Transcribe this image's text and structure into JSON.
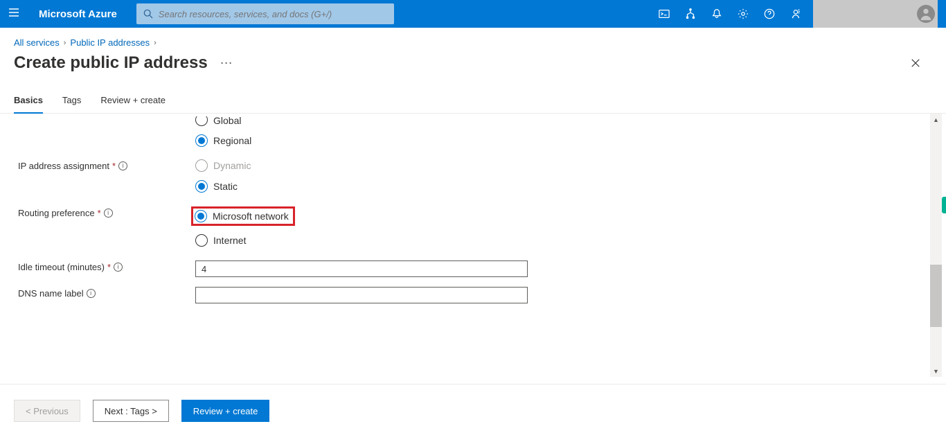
{
  "header": {
    "brand": "Microsoft Azure",
    "search_placeholder": "Search resources, services, and docs (G+/)"
  },
  "breadcrumb": {
    "items": [
      "All services",
      "Public IP addresses"
    ]
  },
  "page": {
    "title": "Create public IP address"
  },
  "tabs": [
    "Basics",
    "Tags",
    "Review + create"
  ],
  "form": {
    "tier": {
      "options": {
        "global": "Global",
        "regional": "Regional"
      }
    },
    "ip_assignment": {
      "label": "IP address assignment",
      "options": {
        "dynamic": "Dynamic",
        "static_": "Static"
      }
    },
    "routing": {
      "label": "Routing preference",
      "options": {
        "msnet": "Microsoft network",
        "internet": "Internet"
      }
    },
    "idle": {
      "label": "Idle timeout (minutes)",
      "value": "4"
    },
    "dns": {
      "label": "DNS name label",
      "value": ""
    }
  },
  "footer": {
    "prev": "< Previous",
    "next": "Next : Tags >",
    "review": "Review + create"
  }
}
